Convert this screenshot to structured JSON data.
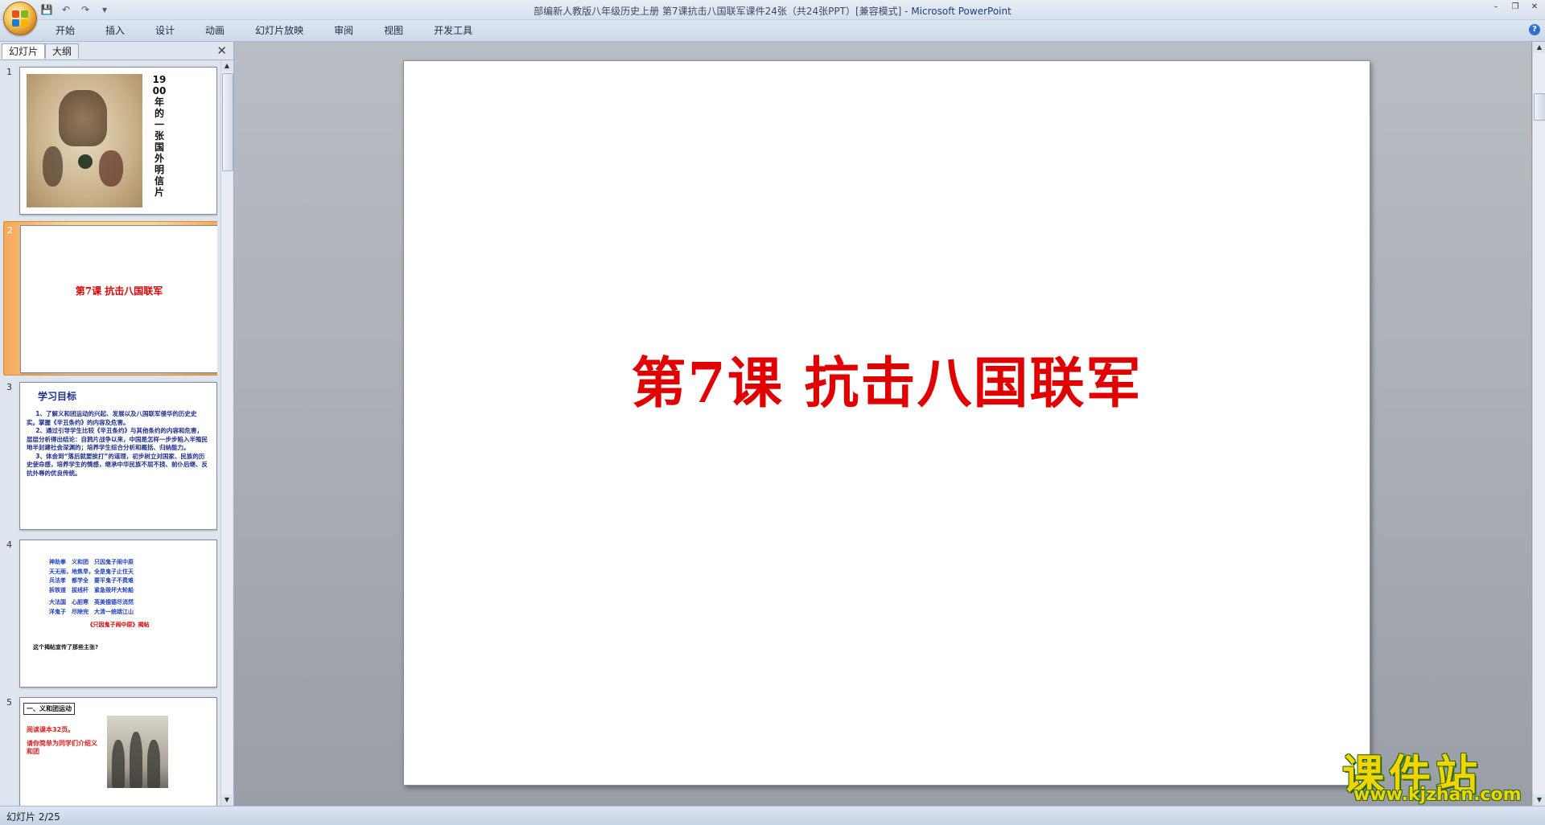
{
  "window": {
    "title": "部编新人教版八年级历史上册 第7课抗击八国联军课件24张（共24张PPT）[兼容模式]",
    "separator": " - ",
    "app_name": "Microsoft PowerPoint",
    "minimize": "–",
    "restore": "❐",
    "close": "✕"
  },
  "qat": {
    "save_icon": "💾",
    "undo_icon": "↶",
    "redo_icon": "↷",
    "customize_icon": "▾"
  },
  "ribbon": {
    "tabs": [
      "开始",
      "插入",
      "设计",
      "动画",
      "幻灯片放映",
      "审阅",
      "视图",
      "开发工具"
    ],
    "help": "?"
  },
  "left_pane": {
    "tab_slides": "幻灯片",
    "tab_outline": "大纲",
    "close": "✕"
  },
  "thumbnails": {
    "s1": {
      "num": "1",
      "vertical_title": "1900年的一张国外明信片"
    },
    "s2": {
      "num": "2",
      "title": "第7课  抗击八国联军"
    },
    "s3": {
      "num": "3",
      "heading": "学习目标",
      "p1": "1、了解义和团运动的兴起、发展以及八国联军侵华的历史史实。掌握《辛丑条约》的内容及危害。",
      "p2": "2、通过引导学生比较《辛丑条约》与其他条约的内容和危害，层层分析得出结论：自鸦片战争以来，中国是怎样一步步陷入半殖民地半封建社会深渊的；培养学生综合分析和概括、归纳能力。",
      "p3": "3、体会到“落后就要挨打”的道理，初步树立对国家、民族的历史使命感，培养学生的情感，继承中华民族不屈不挠、前仆后继、反抗外辱的优良传统。"
    },
    "s4": {
      "num": "4",
      "lines": [
        "神助拳　义和团　只因鬼子闹中原",
        "天无雨，地焦旱，全是鬼子止住天",
        "兵法孝　都学全　要平鬼子不费难",
        "拆铁道　拔线杆　紧急毁坏大轮船",
        "大法国　心胆寒　英美俄德尽消然",
        "洋鬼子　尽除完　大清一统靖江山"
      ],
      "caption": "《只因鬼子闹中原》揭帖",
      "question": "这个揭帖宣传了那些主张?"
    },
    "s5": {
      "num": "5",
      "box": "一、义和团运动",
      "line1": "阅读课本32页。",
      "line2": "请你简单为同学们介绍义和团"
    }
  },
  "slide": {
    "title": "第7课  抗击八国联军"
  },
  "status": {
    "text": "幻灯片 2/25"
  },
  "watermark": {
    "cn": "课件站",
    "url": "www.kjzhan.com"
  },
  "colors": {
    "title_red": "#e00000",
    "blue_text": "#1f2f8f",
    "accent_orange": "#f3a95a",
    "watermark_yellow": "#f2d500"
  }
}
